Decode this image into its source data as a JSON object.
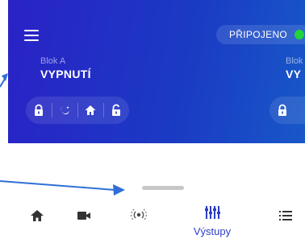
{
  "header": {
    "connection_label": "PŘIPOJENO",
    "connection_status_color": "#22d33a"
  },
  "blocks": [
    {
      "name": "Blok A",
      "state": "VYPNUTÍ"
    },
    {
      "name": "Blok",
      "state": "VY"
    }
  ],
  "mode_buttons": [
    {
      "icon": "lock-icon"
    },
    {
      "icon": "moon-star-icon"
    },
    {
      "icon": "home-icon"
    },
    {
      "icon": "unlock-icon"
    }
  ],
  "bottom_nav": {
    "items": [
      {
        "icon": "home-icon",
        "label": ""
      },
      {
        "icon": "camera-icon",
        "label": ""
      },
      {
        "icon": "sensor-icon",
        "label": ""
      },
      {
        "icon": "outputs-icon",
        "label": "Výstupy",
        "active": true
      },
      {
        "icon": "list-icon",
        "label": ""
      }
    ],
    "active_color": "#2c3ec5",
    "inactive_color": "#333333"
  },
  "colors": {
    "panel_gradient_start": "#2a22c6",
    "panel_gradient_end": "#1858c8",
    "annotation_arrow": "#2f6fd6"
  }
}
